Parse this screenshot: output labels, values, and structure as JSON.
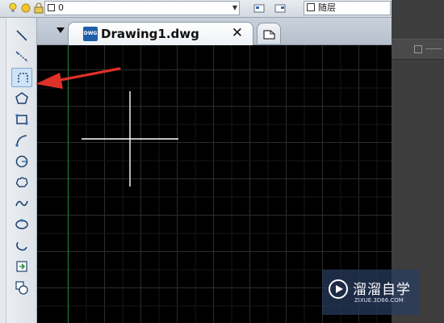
{
  "toolbar_top": {
    "layer_value": "0",
    "linetype_value": "随层"
  },
  "tabs": [
    {
      "label": "Drawing1.dwg",
      "icon": "dwg-file-icon",
      "close_label": "✕"
    }
  ],
  "draw_tools": [
    {
      "name": "line-tool-icon"
    },
    {
      "name": "construction-line-tool-icon"
    },
    {
      "name": "polyline-tool-icon"
    },
    {
      "name": "polygon-tool-icon"
    },
    {
      "name": "rectangle-tool-icon"
    },
    {
      "name": "arc-tool-icon"
    },
    {
      "name": "circle-tool-icon"
    },
    {
      "name": "revision-cloud-tool-icon"
    },
    {
      "name": "spline-tool-icon"
    },
    {
      "name": "ellipse-tool-icon"
    },
    {
      "name": "ellipse-arc-tool-icon"
    },
    {
      "name": "insert-block-tool-icon"
    },
    {
      "name": "make-block-tool-icon"
    }
  ],
  "active_tool": "polyline-tool-icon",
  "watermark": {
    "title": "溜溜自学",
    "url": "ZIXUE.3D66.COM"
  },
  "colors": {
    "canvas_bg": "#000000",
    "grid_line": "#2a2a2a",
    "y_axis": "#1f7a3a",
    "crosshair": "#ffffff",
    "annotation_arrow": "#e0302a"
  }
}
